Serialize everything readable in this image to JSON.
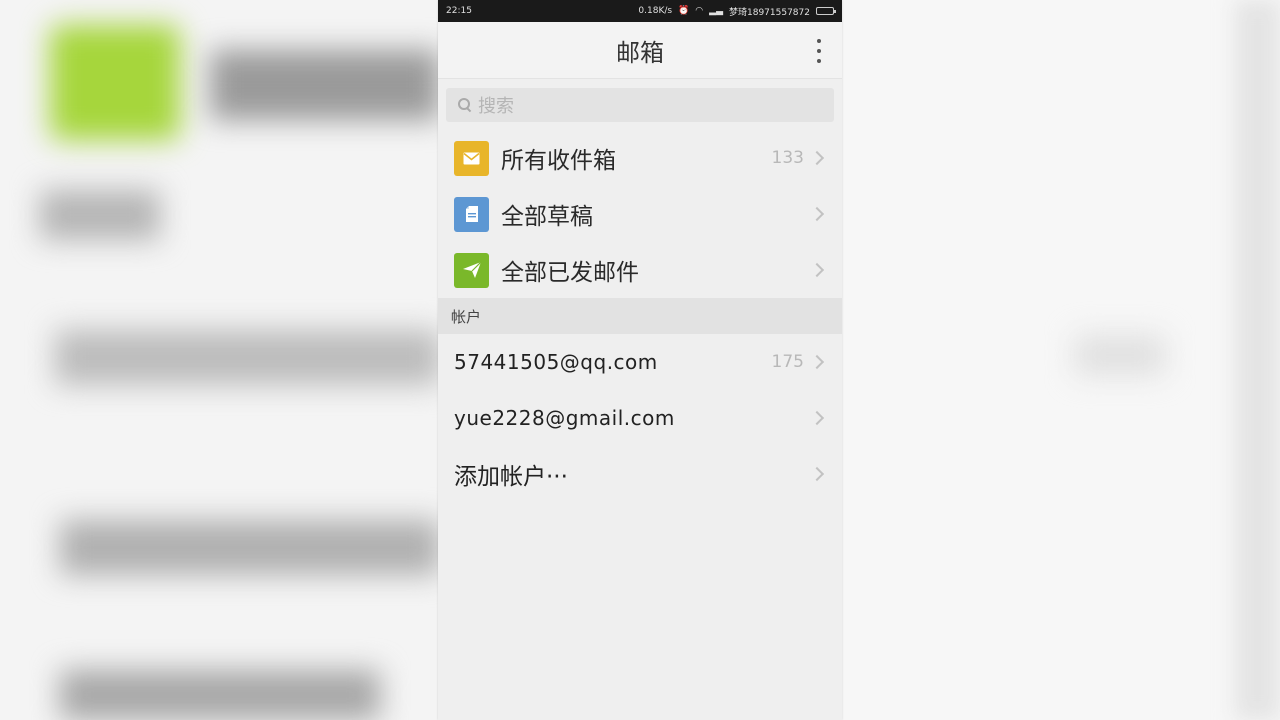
{
  "status_bar": {
    "time": "22:15",
    "network_speed": "0.18K/s",
    "carrier": "梦琦18971557872"
  },
  "header": {
    "title": "邮箱"
  },
  "search": {
    "placeholder": "搜索"
  },
  "mailboxes": [
    {
      "label": "所有收件箱",
      "count": "133",
      "icon": "envelope-icon",
      "color": "#e8b52a"
    },
    {
      "label": "全部草稿",
      "count": "",
      "icon": "draft-icon",
      "color": "#5d97d3"
    },
    {
      "label": "全部已发邮件",
      "count": "",
      "icon": "send-icon",
      "color": "#7ab82a"
    }
  ],
  "accounts_section": {
    "header": "帐户",
    "items": [
      {
        "label": "57441505@qq.com",
        "count": "175"
      },
      {
        "label": "yue2228@gmail.com",
        "count": ""
      },
      {
        "label": "添加帐户···",
        "count": ""
      }
    ]
  }
}
